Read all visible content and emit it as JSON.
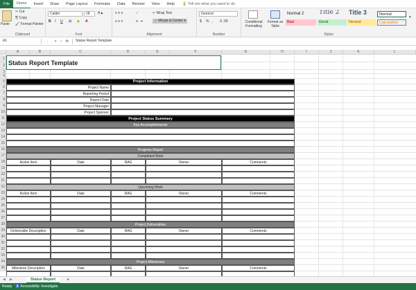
{
  "menu": {
    "tabs": [
      "File",
      "Home",
      "Insert",
      "Draw",
      "Page Layout",
      "Formulas",
      "Data",
      "Review",
      "View",
      "Help"
    ],
    "tell_me": "Tell me what you want to do"
  },
  "ribbon": {
    "clipboard": {
      "paste": "Paste",
      "cut": "Cut",
      "copy": "Copy",
      "format_painter": "Format Painter",
      "label": "Clipboard"
    },
    "font": {
      "name": "Calibri",
      "size": "18",
      "bold": "B",
      "italic": "I",
      "underline": "U",
      "label": "Font"
    },
    "alignment": {
      "wrap": "Wrap Text",
      "merge": "Merge & Center",
      "label": "Alignment"
    },
    "number": {
      "format": "General",
      "currency": "$",
      "percent": "%",
      "comma": ",",
      "label": "Number"
    },
    "styles": {
      "conditional": "Conditional Formatting",
      "format_table": "Format as Table",
      "label": "Styles",
      "items": [
        {
          "text": "Normal 2",
          "bg": "#ffffff",
          "color": "#000000"
        },
        {
          "text": "Title 2",
          "bg": "#ffffff",
          "color": "#44546a"
        },
        {
          "text": "Title 3",
          "bg": "#ffffff",
          "color": "#44546a"
        },
        {
          "text": "Normal",
          "bg": "#ffffff",
          "color": "#000000"
        },
        {
          "text": "Bad",
          "bg": "#ffc7ce",
          "color": "#9c0006"
        },
        {
          "text": "Good",
          "bg": "#c6efce",
          "color": "#006100"
        },
        {
          "text": "Neutral",
          "bg": "#ffeb9c",
          "color": "#9c5700"
        },
        {
          "text": "Calculation",
          "bg": "#f2f2f2",
          "color": "#fa7d00"
        }
      ]
    }
  },
  "formula_bar": {
    "cell_ref": "A1",
    "fx": "fx",
    "content": "Status Report Template"
  },
  "columns": [
    "A",
    "B",
    "C",
    "D",
    "E",
    "F",
    "G",
    "H",
    "I",
    "J",
    "K",
    "L"
  ],
  "rows": [
    "1",
    "2",
    "3",
    "4",
    "5",
    "6",
    "7",
    "8",
    "9",
    "10",
    "11",
    "12",
    "13",
    "14",
    "15",
    "16",
    "17",
    "18",
    "19",
    "20",
    "21",
    "22",
    "23",
    "24",
    "25",
    "26",
    "27",
    "28",
    "29",
    "30",
    "31",
    "32",
    "33",
    "34",
    "35",
    "36"
  ],
  "sheet": {
    "title": "Status Report Template",
    "project_information": "Project Information",
    "info_labels": [
      "Project Name",
      "Reporting Period",
      "Report Date",
      "Project Manager",
      "Project Sponsor"
    ],
    "status_summary": "Project Status Summary",
    "key_accomplishments": "Key Accomplishments",
    "progress_report": "Progress Report",
    "completed_work": "Completed Work",
    "upcoming_work": "Upcoming Work",
    "project_deliverables": "Project Deliverables",
    "project_milestones": "Project Milestones",
    "work_headers": [
      "Action Item",
      "Date",
      "RAG",
      "Owner",
      "Comments"
    ],
    "deliverable_headers": [
      "Deliverable Description",
      "Date",
      "RAG",
      "Owner",
      "Comments"
    ],
    "milestone_headers": [
      "Milestone Description",
      "Date",
      "RAG",
      "Owner",
      "Comments"
    ]
  },
  "sheet_tabs": {
    "active": "Status Report",
    "add": "+"
  },
  "status_bar": {
    "ready": "Ready",
    "accessibility": "Accessibility: Investigate"
  }
}
